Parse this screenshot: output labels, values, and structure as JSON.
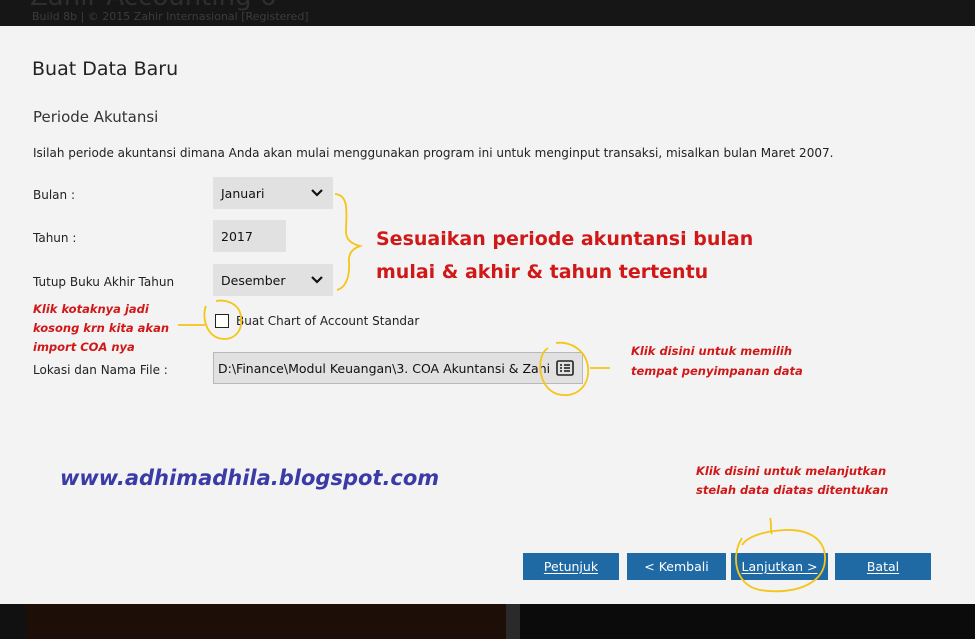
{
  "background": {
    "app_title_fragment": "Build 8b | © 2015 Zahir Internasional [Registered]"
  },
  "dialog": {
    "title": "Buat Data Baru",
    "section_title": "Periode Akutansi",
    "description": "Isilah periode akuntansi dimana Anda akan mulai menggunakan program ini untuk menginput transaksi, misalkan bulan Maret 2007.",
    "fields": {
      "bulan": {
        "label": "Bulan :",
        "value": "Januari"
      },
      "tahun": {
        "label": "Tahun :",
        "value": "2017"
      },
      "tutup_buku": {
        "label": "Tutup Buku Akhir Tahun",
        "value": "Desember"
      },
      "checkbox": {
        "label": "Buat Chart of Account Standar",
        "checked": false
      },
      "lokasi": {
        "label": "Lokasi dan Nama File :",
        "value": "D:\\Finance\\Modul Keuangan\\3. COA Akuntansi & Zahi"
      }
    },
    "buttons": {
      "petunjuk": "Petunjuk",
      "kembali": "< Kembali",
      "lanjutkan": "Lanjutkan >",
      "batal": "Batal"
    }
  },
  "annotations": {
    "periode_line1": "Sesuaikan periode akuntansi bulan",
    "periode_line2": "mulai & akhir & tahun tertentu",
    "checkbox_line1": "Klik kotaknya jadi",
    "checkbox_line2": "kosong krn kita akan",
    "checkbox_line3": "import COA nya",
    "browse_line1": "Klik disini untuk memilih",
    "browse_line2": "tempat penyimpanan data",
    "next_line1": "Klik disini untuk melanjutkan",
    "next_line2": "stelah data diatas ditentukan",
    "blog": "www.adhimadhila.blogspot.com"
  },
  "colors": {
    "button_blue": "#1f6aa5",
    "annotation_red": "#d01818",
    "annotation_yellow": "#f5c518",
    "blog_blue": "#3b3ba8"
  },
  "icons": {
    "dropdown": "chevron-down-icon",
    "browse": "browse-file-icon"
  }
}
